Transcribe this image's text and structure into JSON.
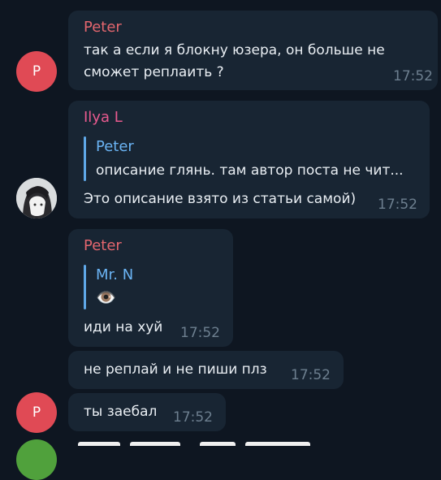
{
  "colors": {
    "background": "#0e1621",
    "bubble": "#182533",
    "name_peter": "#e3666e",
    "name_ilya": "#e85a8f",
    "reply_accent": "#6ab3f3",
    "avatar_p": "#e04a55",
    "avatar_bottom": "#50a13c"
  },
  "messages": [
    {
      "sender": "Peter",
      "lines": [
        "так а если я блокну юзера, он больше не",
        "сможет реплаить ?"
      ],
      "time": "17:52"
    },
    {
      "sender": "Ilya L",
      "reply": {
        "name": "Peter",
        "text": "описание глянь. там автор поста не чит..."
      },
      "text": "Это описание взято из статьи самой)",
      "time": "17:52"
    },
    {
      "sender": "Peter",
      "reply": {
        "name": "Mr. N",
        "text": "👁️"
      },
      "text": "иди на хуй",
      "time": "17:52"
    },
    {
      "text": "не реплай и не пиши плз",
      "time": "17:52"
    },
    {
      "text": "ты заебал",
      "time": "17:52"
    }
  ],
  "avatars": {
    "peter_initial": "P"
  },
  "icons": {
    "ilya_avatar": "anime-avatar-icon",
    "eye": "eye-emoji"
  }
}
